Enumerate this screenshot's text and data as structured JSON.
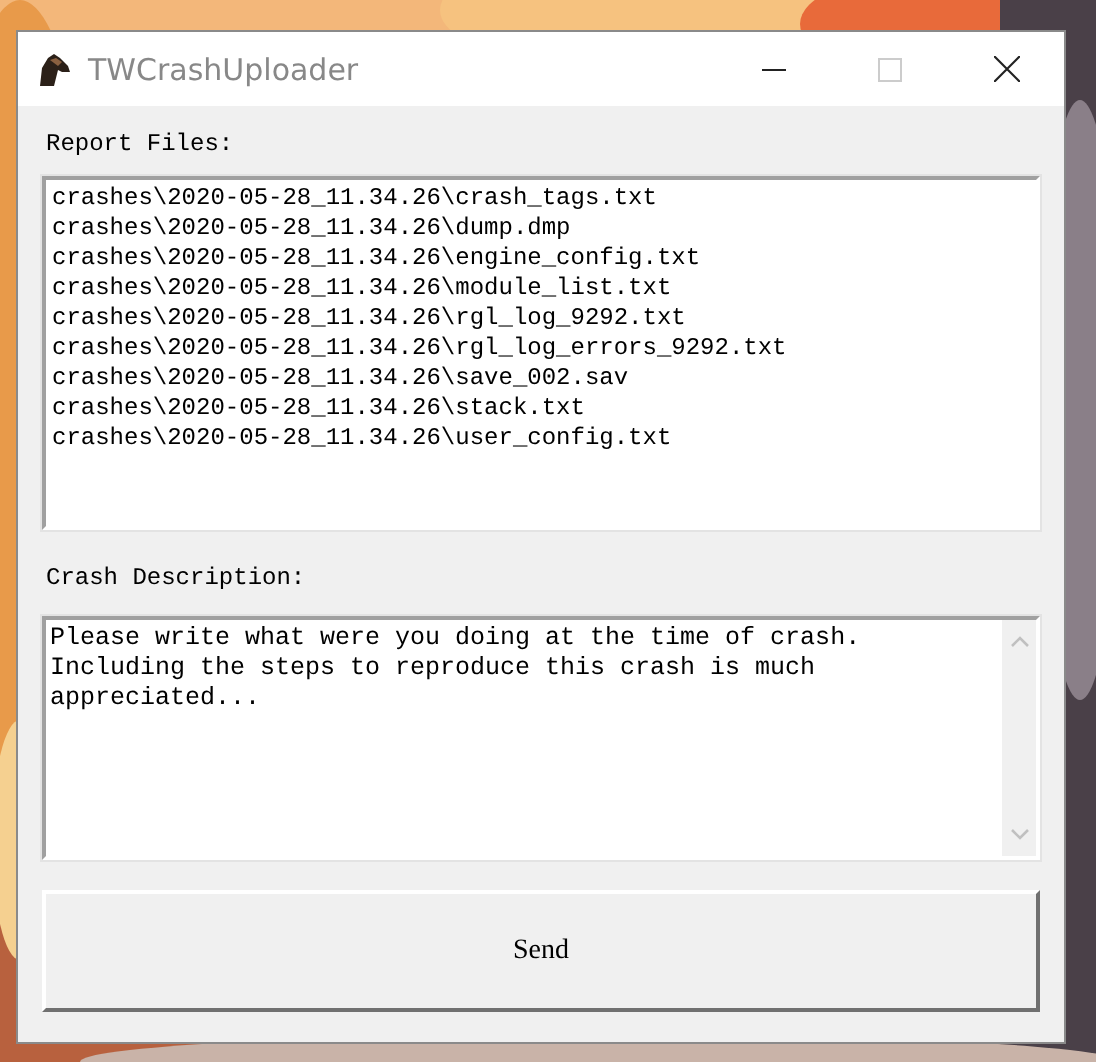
{
  "window": {
    "title": "TWCrashUploader"
  },
  "report_files": {
    "label": "Report Files:",
    "items": [
      "crashes\\2020-05-28_11.34.26\\crash_tags.txt",
      "crashes\\2020-05-28_11.34.26\\dump.dmp",
      "crashes\\2020-05-28_11.34.26\\engine_config.txt",
      "crashes\\2020-05-28_11.34.26\\module_list.txt",
      "crashes\\2020-05-28_11.34.26\\rgl_log_9292.txt",
      "crashes\\2020-05-28_11.34.26\\rgl_log_errors_9292.txt",
      "crashes\\2020-05-28_11.34.26\\save_002.sav",
      "crashes\\2020-05-28_11.34.26\\stack.txt",
      "crashes\\2020-05-28_11.34.26\\user_config.txt"
    ]
  },
  "crash_description": {
    "label": "Crash Description:",
    "value": "Please write what were you doing at the time of crash. Including the steps to reproduce this crash is much appreciated..."
  },
  "buttons": [
    {
      "label": "Send"
    }
  ]
}
